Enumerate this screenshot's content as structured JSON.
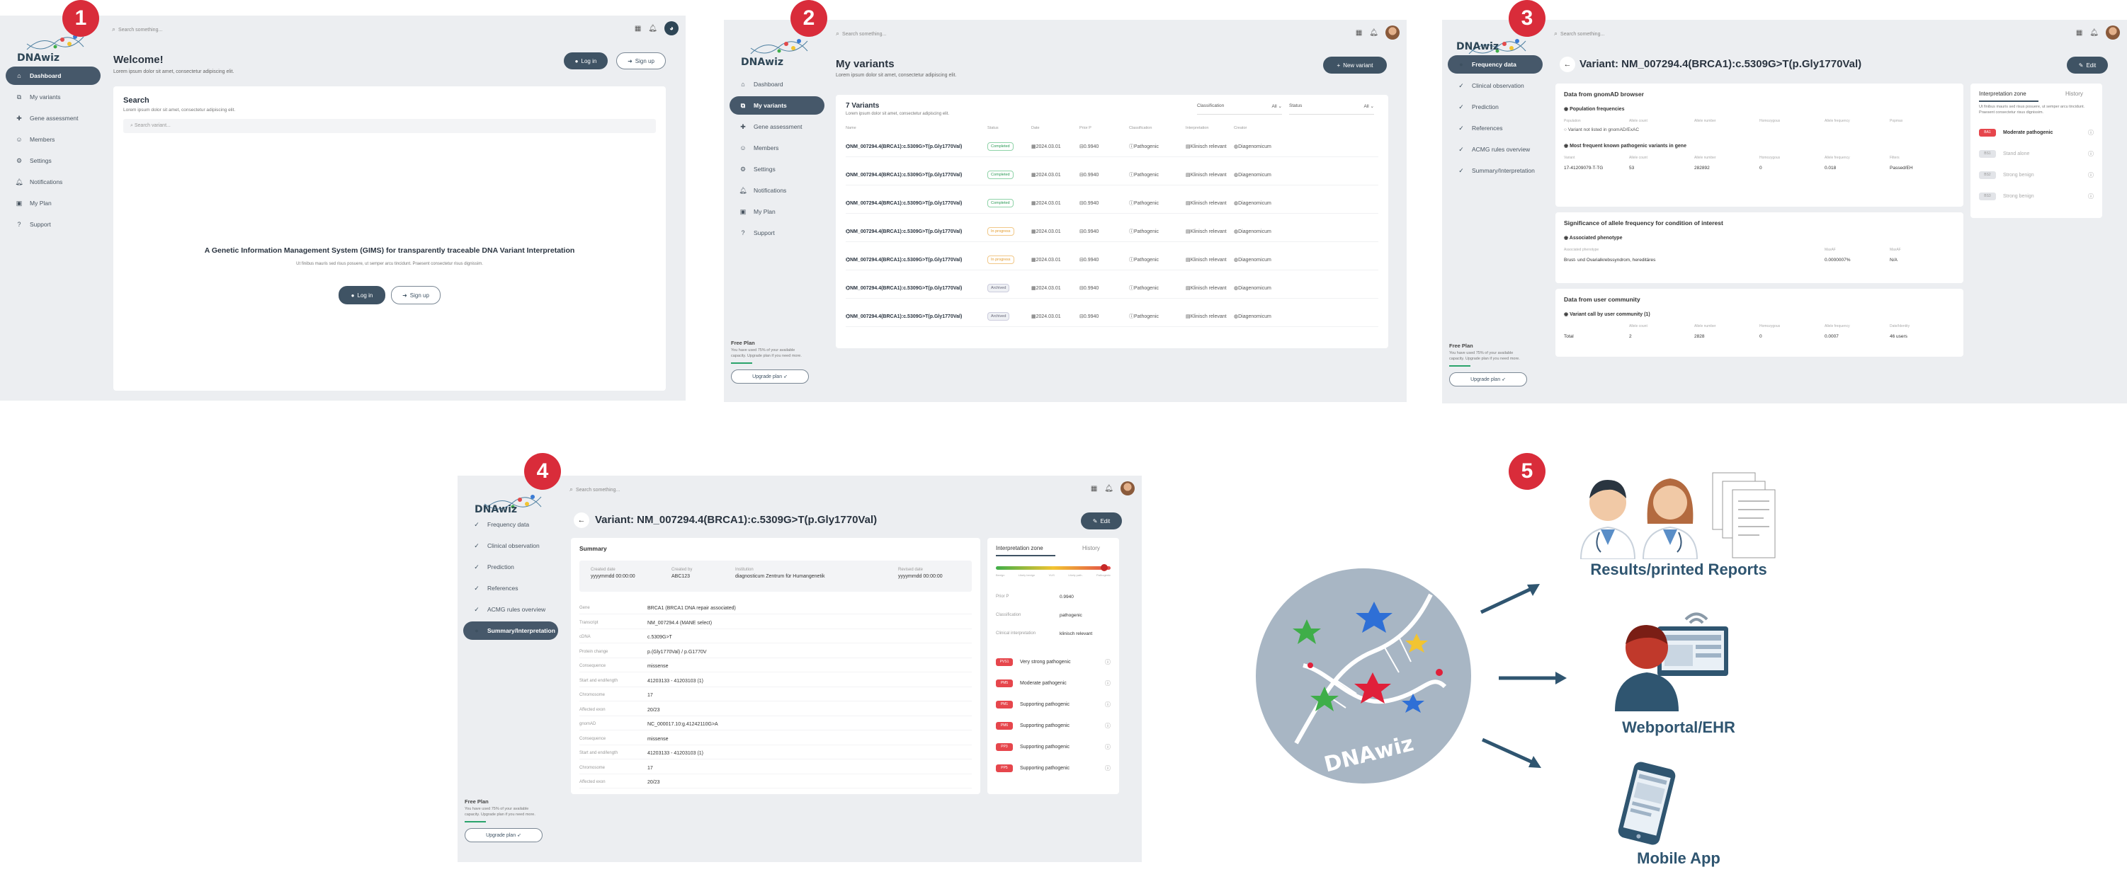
{
  "common": {
    "search_placeholder": "Search something...",
    "brand": "DNAwiz",
    "plan": {
      "title": "Free Plan",
      "desc": "You have used 75% of your available capacity. Upgrade plan if you need more.",
      "upgrade": "Upgrade plan"
    }
  },
  "p1": {
    "num": "1",
    "nav": [
      "Dashboard",
      "My variants",
      "Gene assessment",
      "Members",
      "Settings",
      "Notifications",
      "My Plan",
      "Support"
    ],
    "title": "Welcome!",
    "subtitle": "Lorem ipsum dolor sit amet, consectetur adipiscing elit.",
    "login": "Log in",
    "signup": "Sign up",
    "search_title": "Search",
    "search_sub": "Lorem ipsum dolor sit amet, consectetur adipiscing elit.",
    "search_input": "Search variant...",
    "hero_title": "A Genetic Information Management System (GIMS) for transparently traceable DNA Variant Interpretation",
    "hero_sub": "Ut finibus mauris sed risus posuere, ut semper arcu tincidunt. Praesent consectetur risus dignissim."
  },
  "p2": {
    "num": "2",
    "nav": [
      "Dashboard",
      "My variants",
      "Gene assessment",
      "Members",
      "Settings",
      "Notifications",
      "My Plan",
      "Support"
    ],
    "title": "My variants",
    "subtitle": "Lorem ipsum dolor sit amet, consectetur adipiscing elit.",
    "new_variant": "New variant",
    "count": "7 Variants",
    "count_sub": "Lorem ipsum dolor sit amet, consectetur adipiscing elit.",
    "filter_class": "Classification",
    "filter_status": "Status",
    "filter_all": "All",
    "cols": [
      "Name",
      "Status",
      "Date",
      "Prior P",
      "Classification",
      "Interpretation",
      "Creator"
    ],
    "rows": [
      {
        "name": "NM_007294.4(BRCA1):c.5309G>T(p.Gly1770Val)",
        "status": "Completed",
        "s": "c",
        "date": "2024.03.01",
        "prior": "0.9940",
        "cls": "Pathogenic",
        "interp": "Klinisch relevant",
        "creator": "Diagenomicum"
      },
      {
        "name": "NM_007294.4(BRCA1):c.5309G>T(p.Gly1770Val)",
        "status": "Completed",
        "s": "c",
        "date": "2024.03.01",
        "prior": "0.9940",
        "cls": "Pathogenic",
        "interp": "Klinisch relevant",
        "creator": "Diagenomicum"
      },
      {
        "name": "NM_007294.4(BRCA1):c.5309G>T(p.Gly1770Val)",
        "status": "Completed",
        "s": "c",
        "date": "2024.03.01",
        "prior": "0.9940",
        "cls": "Pathogenic",
        "interp": "Klinisch relevant",
        "creator": "Diagenomicum"
      },
      {
        "name": "NM_007294.4(BRCA1):c.5309G>T(p.Gly1770Val)",
        "status": "In progress",
        "s": "p",
        "date": "2024.03.01",
        "prior": "0.9940",
        "cls": "Pathogenic",
        "interp": "Klinisch relevant",
        "creator": "Diagenomicum"
      },
      {
        "name": "NM_007294.4(BRCA1):c.5309G>T(p.Gly1770Val)",
        "status": "In progress",
        "s": "p",
        "date": "2024.03.01",
        "prior": "0.9940",
        "cls": "Pathogenic",
        "interp": "Klinisch relevant",
        "creator": "Diagenomicum"
      },
      {
        "name": "NM_007294.4(BRCA1):c.5309G>T(p.Gly1770Val)",
        "status": "Archived",
        "s": "a",
        "date": "2024.03.01",
        "prior": "0.9940",
        "cls": "Pathogenic",
        "interp": "Klinisch relevant",
        "creator": "Diagenomicum"
      },
      {
        "name": "NM_007294.4(BRCA1):c.5309G>T(p.Gly1770Val)",
        "status": "Archived",
        "s": "a",
        "date": "2024.03.01",
        "prior": "0.9940",
        "cls": "Pathogenic",
        "interp": "Klinisch relevant",
        "creator": "Diagenomicum"
      }
    ]
  },
  "p3": {
    "num": "3",
    "nav": [
      "Frequency data",
      "Clinical observation",
      "Prediction",
      "References",
      "ACMG rules overview",
      "Summary/Interpretation"
    ],
    "title": "Variant: NM_007294.4(BRCA1):c.5309G>T(p.Gly1770Val)",
    "edit": "Edit",
    "gnomad_title": "Data from gnomAD browser",
    "pop_freq": "Population frequencies",
    "pop_cols": [
      "Population",
      "Allele count",
      "Allele number",
      "Homozygous",
      "Allele frequency",
      "Popmax"
    ],
    "not_listed": "Variant not listed in gnomAD/ExAC",
    "most_freq": "Most frequent known pathogenic variants in gene",
    "mf_cols": [
      "Variant",
      "Allele count",
      "Allele number",
      "Homozygous",
      "Allele frequency",
      "Filters"
    ],
    "mf_row": [
      "17-41209079-T-TG",
      "53",
      "282892",
      "0",
      "0.018",
      "Passed/EH"
    ],
    "sig_title": "Significance of allele frequency for condition of interest",
    "assoc": "Associated phenotype",
    "assoc_cols": [
      "Associated phenotype",
      "MaxAF",
      "MaxAF"
    ],
    "assoc_row": [
      "Brust- und Ovarialkrebssyndrom, hereditäres",
      "0.0000007%",
      "N/A"
    ],
    "user_title": "Data from user community",
    "called": "Variant call by user community (1)",
    "user_cols": [
      "Allele count",
      "Allele number",
      "Homozygous",
      "Allele frequency",
      "Date/Identity"
    ],
    "user_row": [
      "Total",
      "2",
      "2828",
      "0",
      "0.0007",
      "46 users"
    ],
    "tab_interp": "Interpretation zone",
    "tab_history": "History",
    "interp_text": "Ut finibus mauris sed risus posuere, ut semper arcu tincidunt. Praesent consectetur risus dignissim.",
    "criteria": [
      {
        "tag": "BA1",
        "label": "Moderate pathogenic",
        "on": true
      },
      {
        "tag": "BS1",
        "label": "Stand alone",
        "on": false
      },
      {
        "tag": "BS2",
        "label": "Strong benign",
        "on": false
      },
      {
        "tag": "BS3",
        "label": "Strong benign",
        "on": false
      }
    ]
  },
  "p4": {
    "num": "4",
    "nav": [
      "Frequency data",
      "Clinical observation",
      "Prediction",
      "References",
      "ACMG rules overview",
      "Summary/Interpretation"
    ],
    "title": "Variant: NM_007294.4(BRCA1):c.5309G>T(p.Gly1770Val)",
    "edit": "Edit",
    "summary": "Summary",
    "meta": [
      {
        "l": "Created date",
        "v": "yyyymmdd   00:00:00"
      },
      {
        "l": "Created by",
        "v": "ABC123"
      },
      {
        "l": "Institution",
        "v": "diagnosticum Zentrum für Humangenetik"
      },
      {
        "l": "Revised date",
        "v": "yyyymmdd   00:00:00"
      }
    ],
    "fields": [
      {
        "l": "Gene",
        "v": "BRCA1 (BRCA1 DNA repair associated)"
      },
      {
        "l": "Transcript",
        "v": "NM_007294.4 (MANE select)"
      },
      {
        "l": "cDNA",
        "v": "c.5309G>T"
      },
      {
        "l": "Protein change",
        "v": "p.(Gly1770Val) / p.G1770V"
      },
      {
        "l": "Consequence",
        "v": "missense"
      },
      {
        "l": "Start and end/length",
        "v": "41203133 - 41203103 (1)"
      },
      {
        "l": "Chromosome",
        "v": "17"
      },
      {
        "l": "Affected exon",
        "v": "20/23"
      },
      {
        "l": "gnomAD",
        "v": "NC_000017.10:g.41242110G>A"
      },
      {
        "l": "Consequence",
        "v": "missense"
      },
      {
        "l": "Start and end/length",
        "v": "41203133 - 41203103 (1)"
      },
      {
        "l": "Chromosome",
        "v": "17"
      },
      {
        "l": "Affected exon",
        "v": "20/23"
      }
    ],
    "tab_interp": "Interpretation zone",
    "tab_history": "History",
    "scale": [
      "Benign",
      "Likely benign",
      "VUS",
      "Likely path.",
      "Pathogenic"
    ],
    "info": [
      {
        "l": "Prior P",
        "v": "0.9940"
      },
      {
        "l": "Classification",
        "v": "pathogenic"
      },
      {
        "l": "Clinical interpretation",
        "v": "klinisch relevant"
      }
    ],
    "criteria": [
      {
        "tag": "PVS1",
        "label": "Very strong pathogenic"
      },
      {
        "tag": "PM5",
        "label": "Moderate pathogenic"
      },
      {
        "tag": "PM1",
        "label": "Supporting pathogenic"
      },
      {
        "tag": "PM6",
        "label": "Supporting pathogenic"
      },
      {
        "tag": "PP3",
        "label": "Supporting pathogenic"
      },
      {
        "tag": "PP5",
        "label": "Supporting pathogenic"
      }
    ]
  },
  "p5": {
    "num": "5",
    "logo": "DNAwiz",
    "outputs": [
      "Results/printed Reports",
      "Webportal/EHR",
      "Mobile App"
    ]
  }
}
